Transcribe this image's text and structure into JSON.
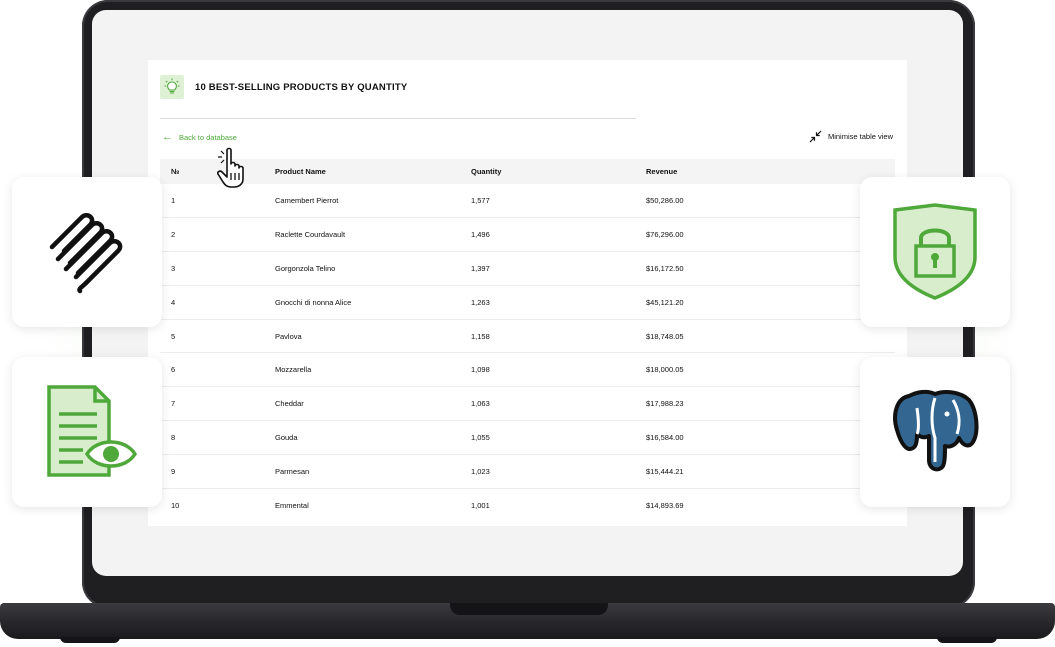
{
  "report": {
    "title": "10 BEST-SELLING PRODUCTS BY QUANTITY",
    "back_label": "Back to database",
    "minimise_label": "Minimise table view"
  },
  "table": {
    "headers": [
      "№",
      "Product Name",
      "Quantity",
      "Revenue"
    ],
    "rows": [
      [
        "1",
        "Camembert Pierrot",
        "1,577",
        "$50,286.00"
      ],
      [
        "2",
        "Raclette Courdavault",
        "1,496",
        "$76,296.00"
      ],
      [
        "3",
        "Gorgonzola Telino",
        "1,397",
        "$16,172.50"
      ],
      [
        "4",
        "Gnocchi di nonna Alice",
        "1,263",
        "$45,121.20"
      ],
      [
        "5",
        "Pavlova",
        "1,158",
        "$18,748.05"
      ],
      [
        "6",
        "Mozzarella",
        "1,098",
        "$18,000.05"
      ],
      [
        "7",
        "Cheddar",
        "1,063",
        "$17,988.23"
      ],
      [
        "8",
        "Gouda",
        "1,055",
        "$16,584.00"
      ],
      [
        "9",
        "Parmesan",
        "1,023",
        "$15,444.21"
      ],
      [
        "10",
        "Emmental",
        "1,001",
        "$14,893.69"
      ]
    ]
  },
  "icons": {
    "title": "lightbulb-icon",
    "back": "arrow-left-icon",
    "minimise": "collapse-icon",
    "cursor": "hand-pointer-icon",
    "tile_top_left": "spring-coil-icon",
    "tile_bottom_left": "document-view-icon",
    "tile_top_right": "security-shield-lock-icon",
    "tile_bottom_right": "postgresql-elephant-icon"
  },
  "colors": {
    "accent_green": "#4fa83a",
    "postgres_blue": "#336791"
  }
}
